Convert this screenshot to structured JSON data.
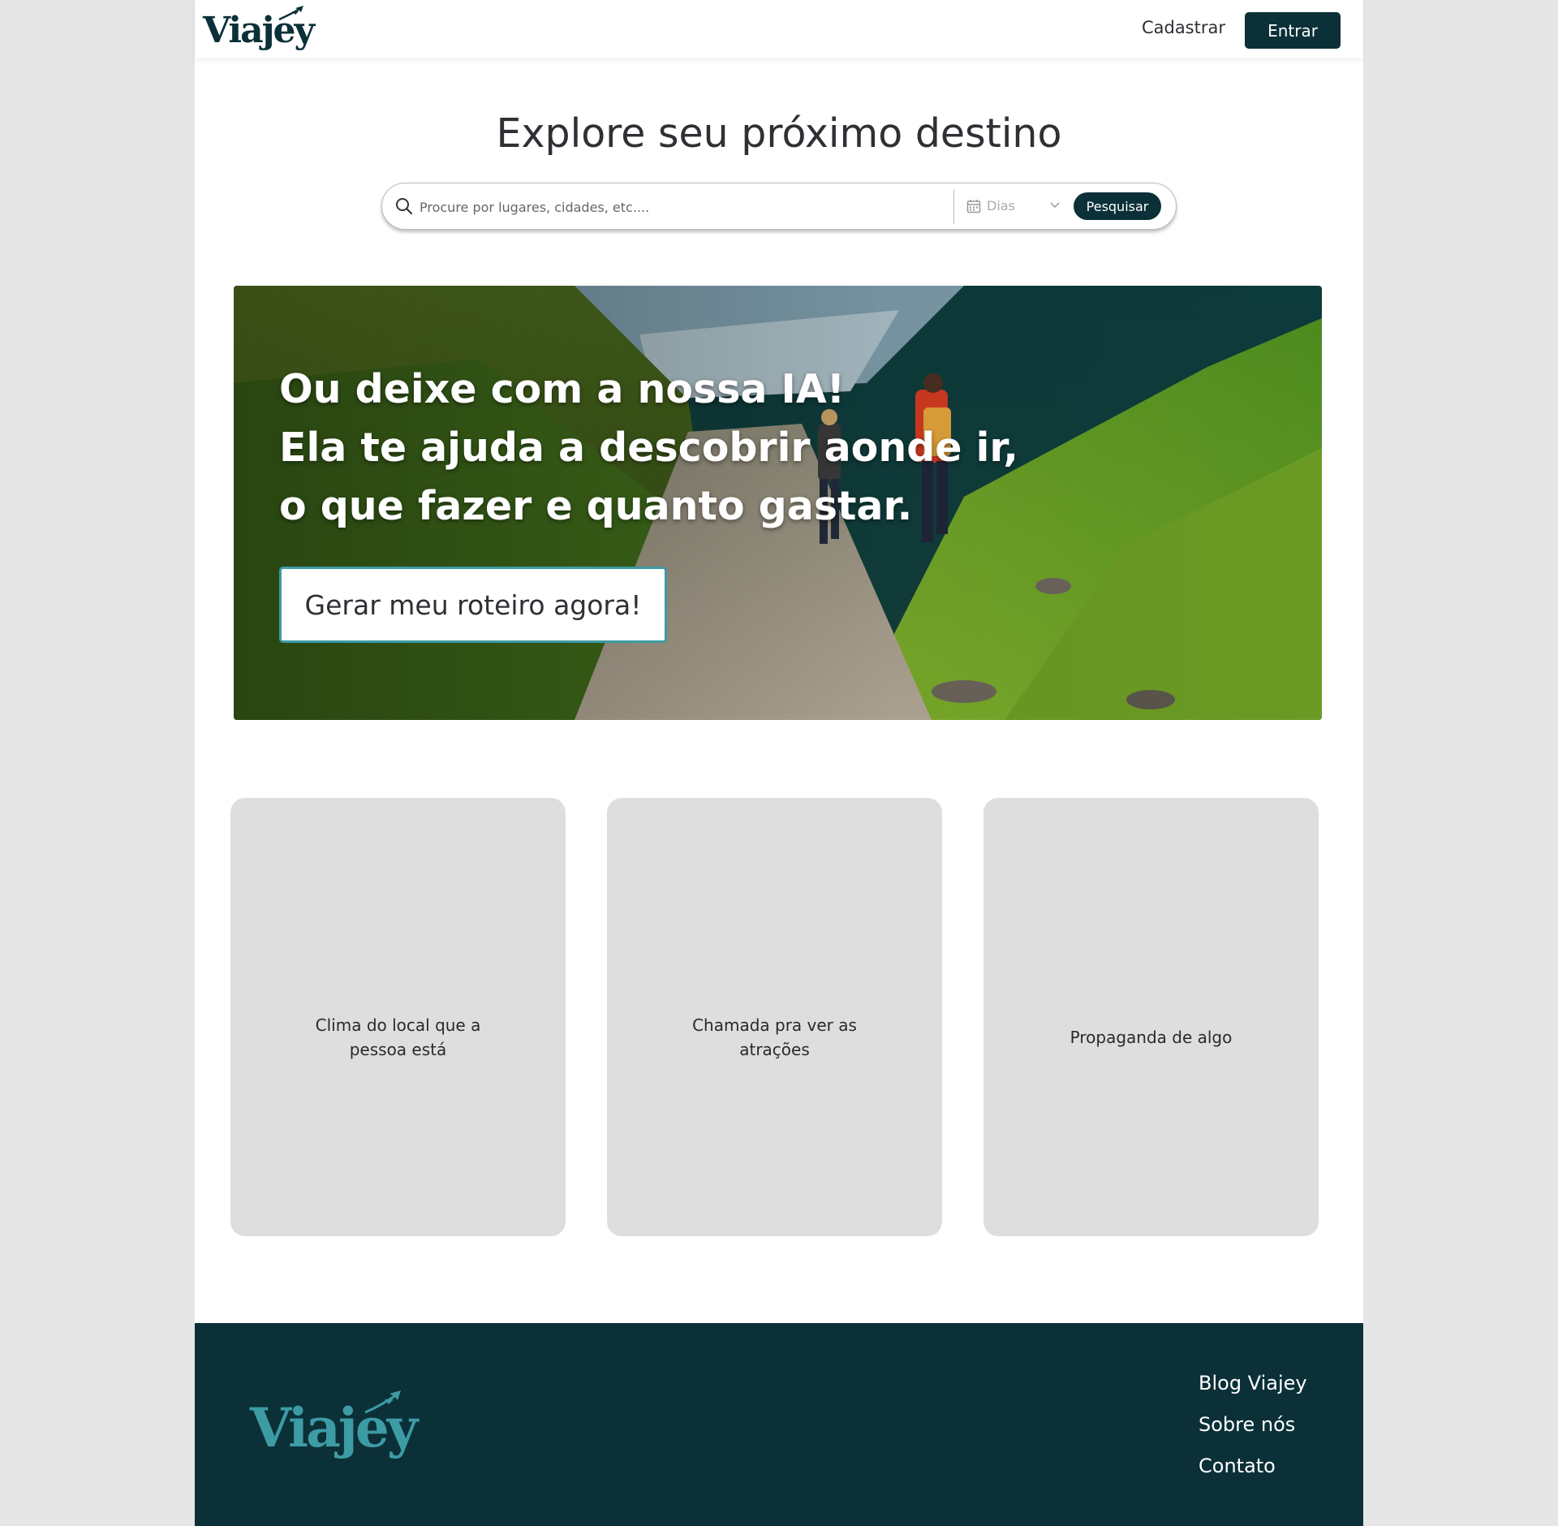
{
  "header": {
    "logo": "Viajey",
    "signup_label": "Cadastrar",
    "login_label": "Entrar"
  },
  "hero": {
    "title": "Explore seu próximo destino",
    "search": {
      "placeholder": "Procure por lugares, cidades, etc....",
      "days_label": "Dias",
      "button_label": "Pesquisar"
    }
  },
  "banner": {
    "lines": [
      "Ou deixe com a nossa IA!",
      "Ela te ajuda a descobrir aonde ir,",
      "o que fazer e quanto gastar."
    ],
    "cta_label": "Gerar meu roteiro agora!"
  },
  "cards": [
    {
      "text": "Clima do local que a pessoa está"
    },
    {
      "text": "Chamada pra ver as atrações"
    },
    {
      "text": "Propaganda de algo"
    }
  ],
  "footer": {
    "logo": "Viajey",
    "links": [
      "Blog Viajey",
      "Sobre nós",
      "Contato"
    ]
  },
  "colors": {
    "brand_dark": "#0b3038",
    "brand_teal": "#3d9ba4",
    "card_bg": "#dedede"
  },
  "icons": [
    "plane-icon",
    "search-icon",
    "calendar-icon",
    "chevron-down-icon"
  ]
}
